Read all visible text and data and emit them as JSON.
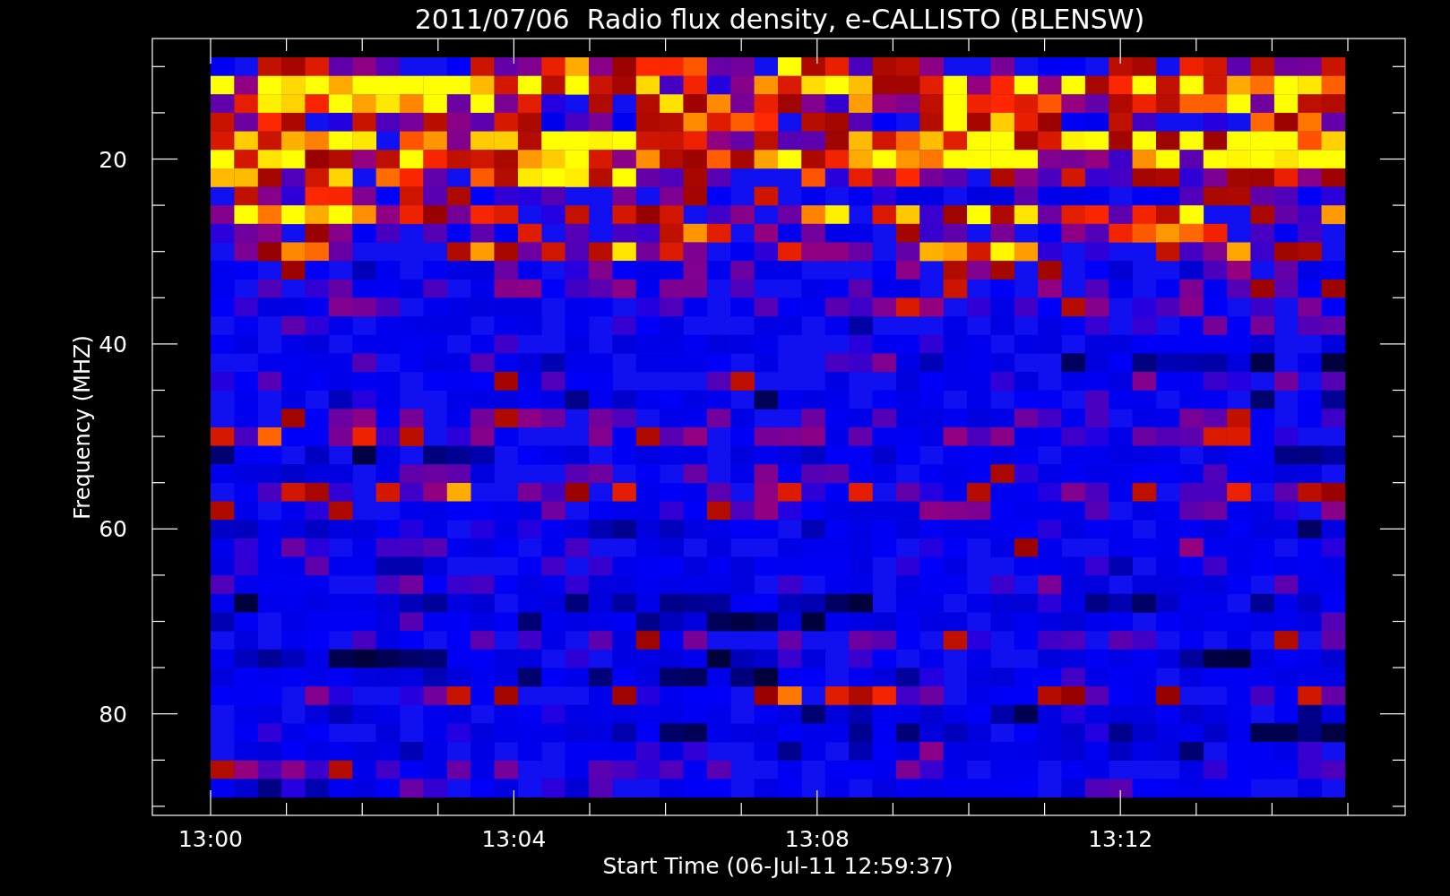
{
  "title": "2011/07/06  Radio flux density, e-CALLISTO (BLENSW)",
  "y_axis": {
    "label": "Frequency (MHZ)",
    "ticks": [
      "20",
      "40",
      "60",
      "80"
    ]
  },
  "x_axis": {
    "label": "Start Time (06-Jul-11 12:59:37)",
    "ticks": [
      "13:00",
      "13:04",
      "13:08",
      "13:12"
    ]
  }
}
